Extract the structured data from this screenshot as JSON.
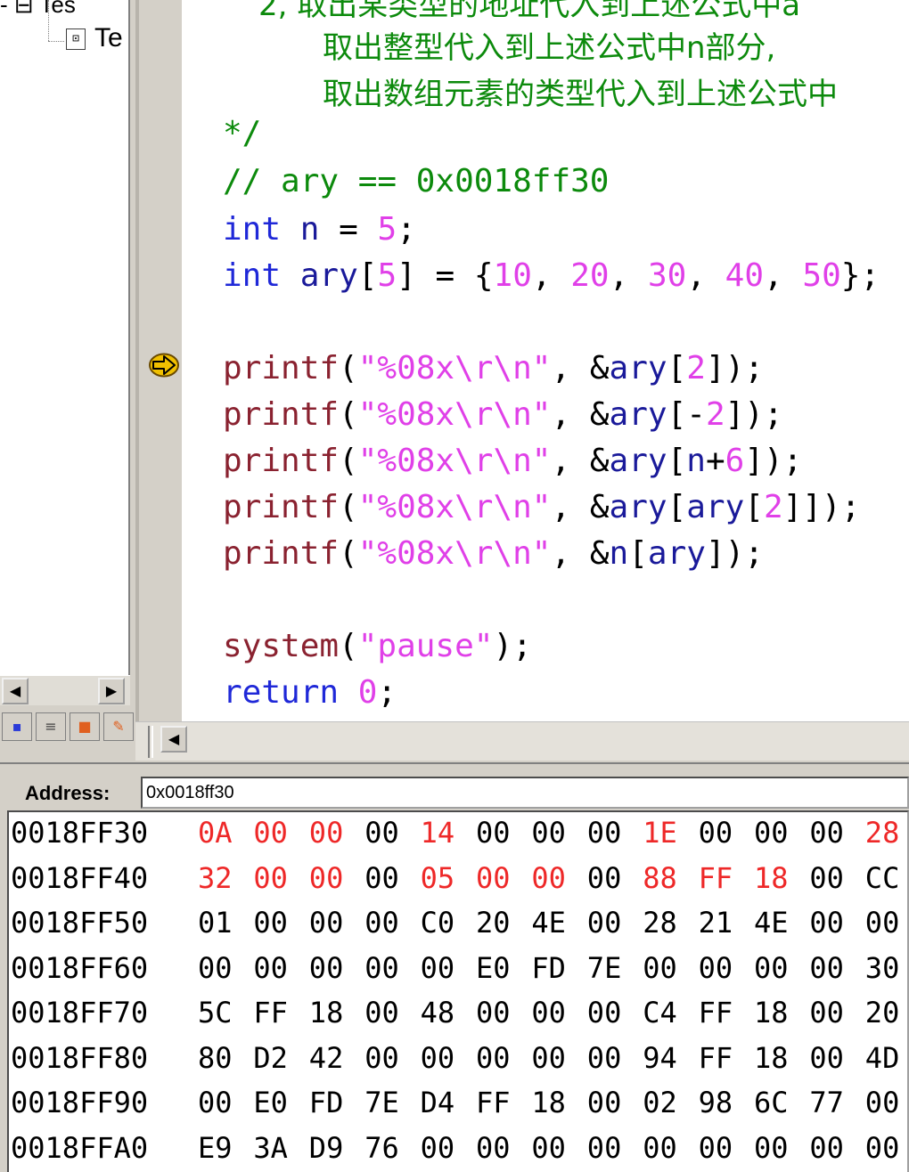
{
  "tree": {
    "top_item": "- ⊟ Tes",
    "file_icon": "⊡",
    "file_label": "Te"
  },
  "scroll_icons": {
    "left": "◀",
    "right": "▶"
  },
  "workspace_tabs": [
    {
      "name": "class-view-tab",
      "icon": "▪",
      "color": "#2a3ad8"
    },
    {
      "name": "resource-view-tab",
      "icon": "≡",
      "color": "#404040"
    },
    {
      "name": "file-view-tab",
      "icon": "■",
      "color": "#e06020"
    },
    {
      "name": "info-view-tab",
      "icon": "✎",
      "color": "#e06020"
    }
  ],
  "editor": {
    "comment_lines": [
      "2, 取出某类型的地址代入到上述公式中a",
      "取出整型代入到上述公式中n部分,",
      "取出数组元素的类型代入到上述公式中"
    ],
    "comment_close": "*/",
    "addr_comment": "// ary == 0x0018ff30",
    "decl_n": {
      "kw": "int",
      "id": "n",
      "eq": " = ",
      "val": "5",
      "end": ";"
    },
    "decl_ary": {
      "kw": "int",
      "id": "ary",
      "lb": "[",
      "size": "5",
      "rb": "]",
      "eq": " = {",
      "vals": [
        "10",
        "20",
        "30",
        "40",
        "50"
      ],
      "end": "};"
    },
    "printf_fn": "printf",
    "printf_fmt": "\"%08x\\r\\n\"",
    "printf_args": [
      {
        "pre": "&ary[",
        "parts": [
          {
            "t": "num",
            "v": "2"
          }
        ],
        "post": "]);"
      },
      {
        "pre": "&ary[",
        "parts": [
          {
            "t": "pn",
            "v": "-"
          },
          {
            "t": "num",
            "v": "2"
          }
        ],
        "post": "]);"
      },
      {
        "pre": "&ary[",
        "parts": [
          {
            "t": "id",
            "v": "n"
          },
          {
            "t": "pn",
            "v": "+"
          },
          {
            "t": "num",
            "v": "6"
          }
        ],
        "post": "]);"
      },
      {
        "pre": "&ary[",
        "parts": [
          {
            "t": "id",
            "v": "ary"
          },
          {
            "t": "pn",
            "v": "["
          },
          {
            "t": "num",
            "v": "2"
          },
          {
            "t": "pn",
            "v": "]"
          }
        ],
        "post": "]);"
      },
      {
        "pre": "&n[",
        "parts": [
          {
            "t": "id",
            "v": "ary"
          }
        ],
        "post": "]);"
      }
    ],
    "system_fn": "system",
    "system_arg": "\"pause\"",
    "return_kw": "return",
    "return_val": "0"
  },
  "memory": {
    "address_label": "Address:",
    "address_value": "0x0018ff30",
    "rows": [
      {
        "addr": "0018FF30",
        "bytes": [
          "0A",
          "00",
          "00",
          "00",
          "14",
          "00",
          "00",
          "00",
          "1E",
          "00",
          "00",
          "00",
          "28"
        ],
        "changed": [
          0,
          1,
          2,
          4,
          8,
          12
        ]
      },
      {
        "addr": "0018FF40",
        "bytes": [
          "32",
          "00",
          "00",
          "00",
          "05",
          "00",
          "00",
          "00",
          "88",
          "FF",
          "18",
          "00",
          "CC"
        ],
        "changed": [
          0,
          1,
          2,
          4,
          5,
          6,
          8,
          9,
          10
        ]
      },
      {
        "addr": "0018FF50",
        "bytes": [
          "01",
          "00",
          "00",
          "00",
          "C0",
          "20",
          "4E",
          "00",
          "28",
          "21",
          "4E",
          "00",
          "00"
        ],
        "changed": []
      },
      {
        "addr": "0018FF60",
        "bytes": [
          "00",
          "00",
          "00",
          "00",
          "00",
          "E0",
          "FD",
          "7E",
          "00",
          "00",
          "00",
          "00",
          "30"
        ],
        "changed": []
      },
      {
        "addr": "0018FF70",
        "bytes": [
          "5C",
          "FF",
          "18",
          "00",
          "48",
          "00",
          "00",
          "00",
          "C4",
          "FF",
          "18",
          "00",
          "20"
        ],
        "changed": []
      },
      {
        "addr": "0018FF80",
        "bytes": [
          "80",
          "D2",
          "42",
          "00",
          "00",
          "00",
          "00",
          "00",
          "94",
          "FF",
          "18",
          "00",
          "4D"
        ],
        "changed": []
      },
      {
        "addr": "0018FF90",
        "bytes": [
          "00",
          "E0",
          "FD",
          "7E",
          "D4",
          "FF",
          "18",
          "00",
          "02",
          "98",
          "6C",
          "77",
          "00"
        ],
        "changed": []
      },
      {
        "addr": "0018FFA0",
        "bytes": [
          "E9",
          "3A",
          "D9",
          "76",
          "00",
          "00",
          "00",
          "00",
          "00",
          "00",
          "00",
          "00",
          "00"
        ],
        "changed": []
      }
    ]
  },
  "colors": {
    "comment": "#0c8a0c",
    "keyword": "#1f28d8",
    "function": "#8a2230",
    "string_number": "#e040e8",
    "changed_byte": "#ee2828",
    "breakpoint_arrow": "#f0c000"
  }
}
